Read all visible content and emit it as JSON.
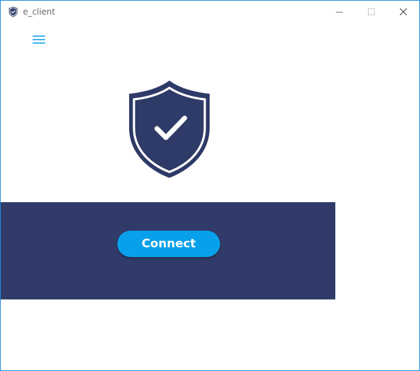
{
  "window": {
    "title": "e_client",
    "controls": {
      "minimize_icon": "minimize-icon",
      "maximize_icon": "maximize-icon",
      "close_icon": "close-icon"
    }
  },
  "toolbar": {
    "menu_icon": "hamburger-menu-icon"
  },
  "status": {
    "icon": "shield-check-icon"
  },
  "panel": {
    "connect_label": "Connect"
  },
  "colors": {
    "accent": "#08a0ea",
    "panel_bg": "#313b69",
    "shield": "#2e3a67",
    "menu_icon": "#3fb4ec",
    "window_border": "#1a8fe0"
  }
}
